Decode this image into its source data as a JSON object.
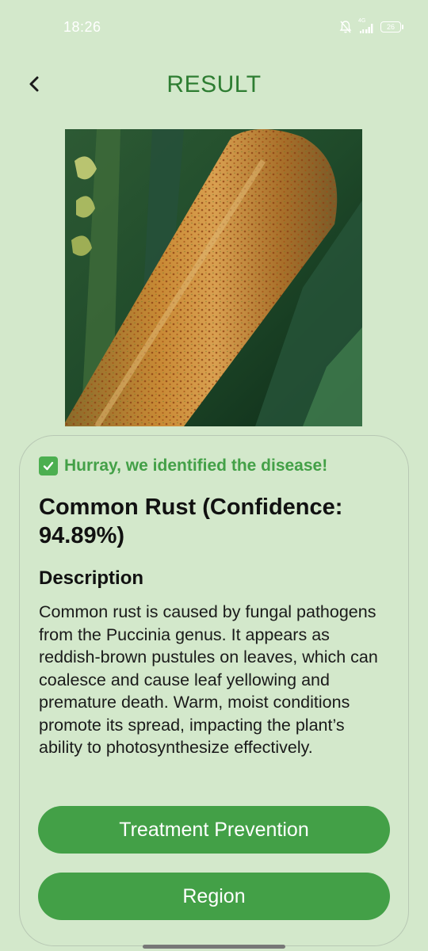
{
  "status_bar": {
    "time": "18:26",
    "network": "4G",
    "battery": "26",
    "icons": [
      "bell-muted-icon",
      "signal-icon",
      "battery-icon"
    ]
  },
  "header": {
    "title": "RESULT",
    "back_icon": "chevron-left-icon"
  },
  "result": {
    "success_icon": "check-mark-icon",
    "success_message": "Hurray, we identified the disease!",
    "disease_title": "Common Rust (Confidence: 94.89%)",
    "description_heading": "Description",
    "description": "Common rust is caused by fungal pathogens from the Puccinia genus. It appears as reddish-brown pustules on leaves, which can coalesce and cause leaf yellowing and premature death. Warm, moist conditions promote its spread, impacting the plant’s ability to photosynthesize effectively."
  },
  "actions": {
    "treatment_label": "Treatment Prevention",
    "region_label": "Region"
  },
  "colors": {
    "background": "#d3e8cb",
    "accent": "#2e7d32",
    "button": "#43a047",
    "success": "#43a047"
  }
}
